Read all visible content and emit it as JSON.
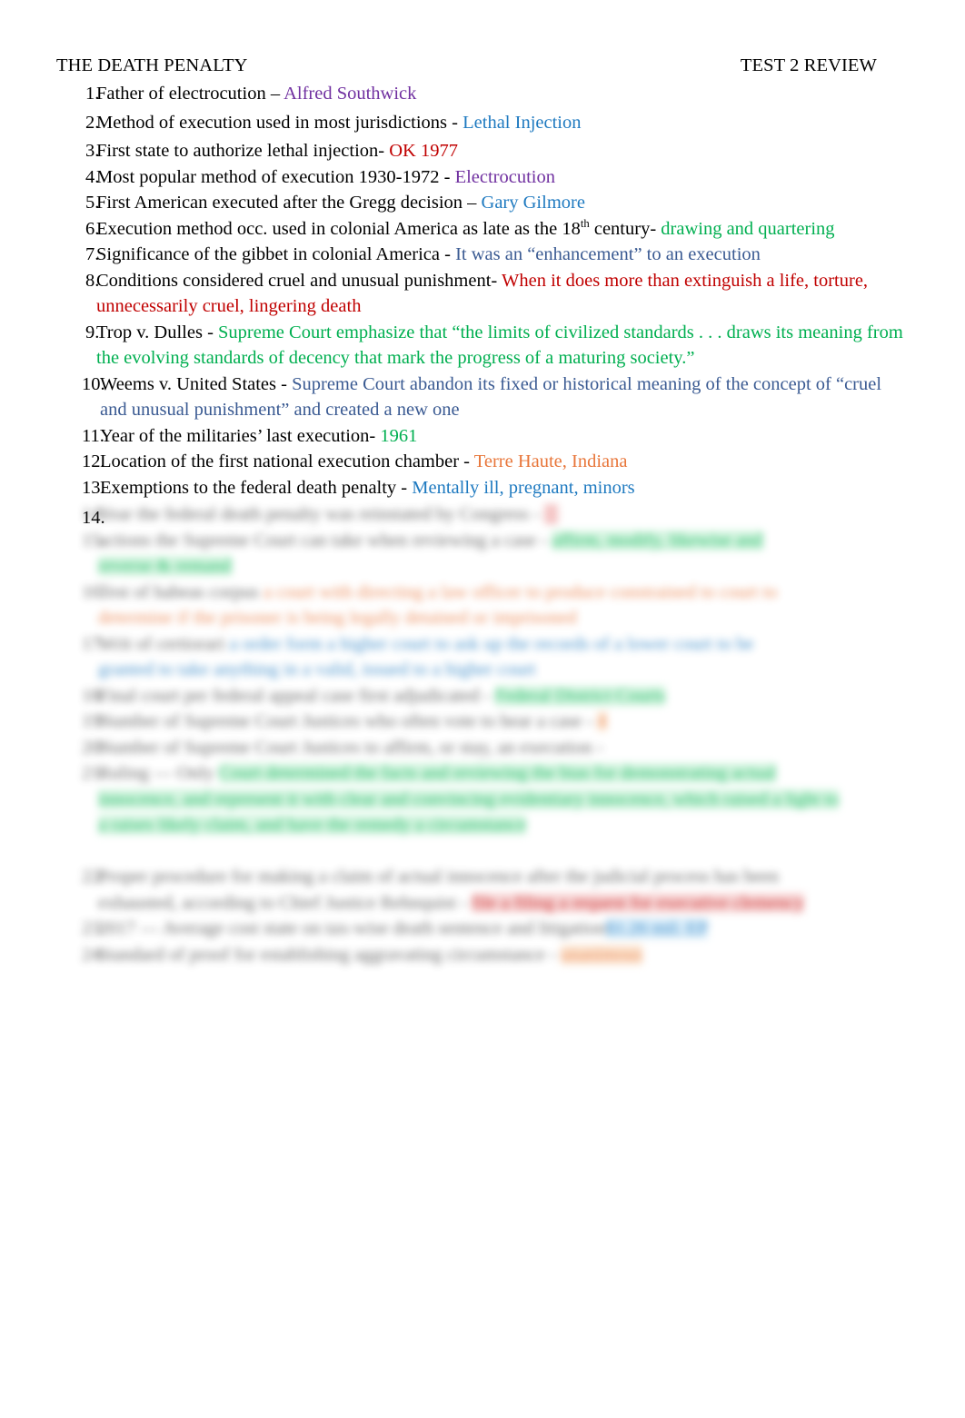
{
  "document": {
    "header_left": "THE DEATH PENALTY",
    "header_right": "TEST 2 REVIEW",
    "paper": "#ffffff",
    "colors": {
      "purple": "#7030A0",
      "blue": "#1F7AC0",
      "red": "#C00000",
      "green": "#00AF50",
      "navy": "#3A5A92",
      "orange": "#E8763A",
      "text": "#000000"
    }
  },
  "items": [
    {
      "number": "1.",
      "question": "Father of electrocution – ",
      "answer": "Alfred Southwick",
      "answer_color": "purple"
    },
    {
      "number": "2.",
      "question": "Method of execution used in most jurisdictions - ",
      "answer": "Lethal Injection",
      "answer_color": "blue"
    },
    {
      "number": "3.",
      "question": "First state to authorize lethal injection- ",
      "answer": "OK 1977",
      "answer_color": "red"
    },
    {
      "number": "4.",
      "question": "Most popular method of execution 1930-1972 - ",
      "answer": "Electrocution",
      "answer_color": "purple"
    },
    {
      "number": "5.",
      "question": "First American executed after the Gregg  decision – ",
      "answer": "Gary Gilmore",
      "answer_color": "blue"
    },
    {
      "number": "6.",
      "question_a": "Execution method occ. used in colonial America as late as the 18",
      "superscript": "th",
      "question_b": " century- ",
      "answer": "drawing and quartering",
      "answer_color": "green"
    },
    {
      "number": "7.",
      "question": "Significance of the gibbet in colonial America - ",
      "answer": "It was an “enhancement” to an execution",
      "answer_color": "navy"
    },
    {
      "number": "8.",
      "question": "Conditions considered cruel and unusual punishment- ",
      "answer": "When it does more than extinguish a life, torture, unnecessarily cruel, lingering death",
      "answer_color": "red"
    },
    {
      "number": "9.",
      "question": "Trop v. Dulles - ",
      "answer": "Supreme Court emphasize that “the limits of civilized standards . . . draws its meaning from the evolving standards of decency that mark the progress of a maturing society.”",
      "answer_color": "green"
    },
    {
      "number": "10.",
      "question": "Weems v. United States - ",
      "answer": "Supreme Court abandon its fixed or historical meaning of the concept of “cruel and unusual punishment” and created a new one",
      "answer_color": "navy"
    },
    {
      "number": "11.",
      "question": "Year of the militaries’ last execution-  ",
      "answer": "1961",
      "answer_color": "green"
    },
    {
      "number": "12.",
      "question": "Location of the first national execution chamber - ",
      "answer": "Terre Haute, Indiana",
      "answer_color": "orange"
    },
    {
      "number": "13.",
      "question": "Exemptions to the federal death penalty - ",
      "answer": "Mentally ill, pregnant, minors",
      "answer_color": "blue"
    },
    {
      "number": "14.",
      "question": "",
      "answer": "",
      "answer_color": "none"
    }
  ],
  "redacted_region": {
    "note": "Lower portion of the page is blurred and illegible",
    "lines": [
      {
        "num": "14.",
        "q_w": 570,
        "hl": "red",
        "hl_w": 36,
        "indent": 0
      },
      {
        "num": "15.",
        "q_w": 600,
        "hl": "green",
        "hl_w": 290,
        "indent": 0
      },
      {
        "num": "",
        "q_w": 0,
        "hl": "green",
        "hl_w": 190,
        "indent": 1
      },
      {
        "num": "16.",
        "q_w": 200,
        "hl": "orange",
        "hl_w": 700,
        "indent": 0
      },
      {
        "num": "",
        "q_w": 0,
        "hl": "orange",
        "hl_w": 590,
        "indent": 1
      },
      {
        "num": "17.",
        "q_w": 190,
        "hl": "blue",
        "hl_w": 715,
        "indent": 0
      },
      {
        "num": "",
        "q_w": 0,
        "hl": "blue",
        "hl_w": 555,
        "indent": 1
      },
      {
        "num": "18.",
        "q_w": 490,
        "hl": "green",
        "hl_w": 215,
        "indent": 0
      },
      {
        "num": "19.",
        "q_w": 600,
        "hl": "orange",
        "hl_w": 18,
        "indent": 0
      },
      {
        "num": "20.",
        "q_w": 560,
        "hl": "none",
        "hl_w": 0,
        "indent": 0
      },
      {
        "num": "21.",
        "q_w": 160,
        "hl": "green",
        "hl_w": 745,
        "indent": 0
      },
      {
        "num": "",
        "q_w": 0,
        "hl": "green",
        "hl_w": 930,
        "indent": 1
      },
      {
        "num": "",
        "q_w": 0,
        "hl": "green",
        "hl_w": 500,
        "indent": 1
      }
    ]
  }
}
